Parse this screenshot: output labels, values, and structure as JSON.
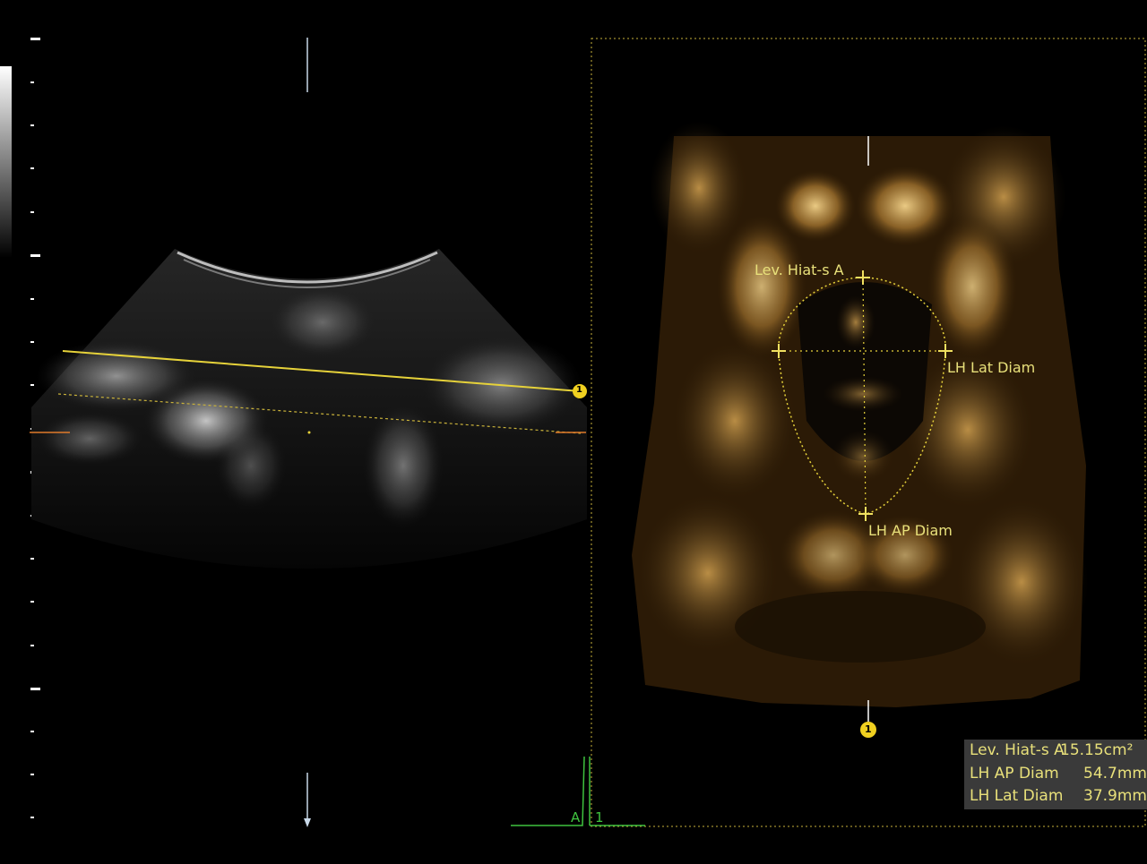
{
  "colors": {
    "annotation": "#e8e07a",
    "yellow_line": "#e6d23a",
    "marker_fill": "#f0d020",
    "green_axis": "#3fc33f",
    "orange_tick": "#e07a2a",
    "box_bg": "#3a3a3a"
  },
  "labels": {
    "lev_hiatus": "Lev. Hiat-s A",
    "lh_lat_diam": "LH Lat Diam",
    "lh_ap_diam": "LH AP Diam"
  },
  "markers": {
    "plane_marker": "1",
    "render_marker": "1"
  },
  "orientation": {
    "axis_a": "A",
    "axis_1": "1"
  },
  "measurements": [
    {
      "name": "Lev. Hiat-s A",
      "value": "15.15cm²"
    },
    {
      "name": "LH AP Diam",
      "value": "54.7mm"
    },
    {
      "name": "LH Lat Diam",
      "value": "37.9mm"
    }
  ]
}
